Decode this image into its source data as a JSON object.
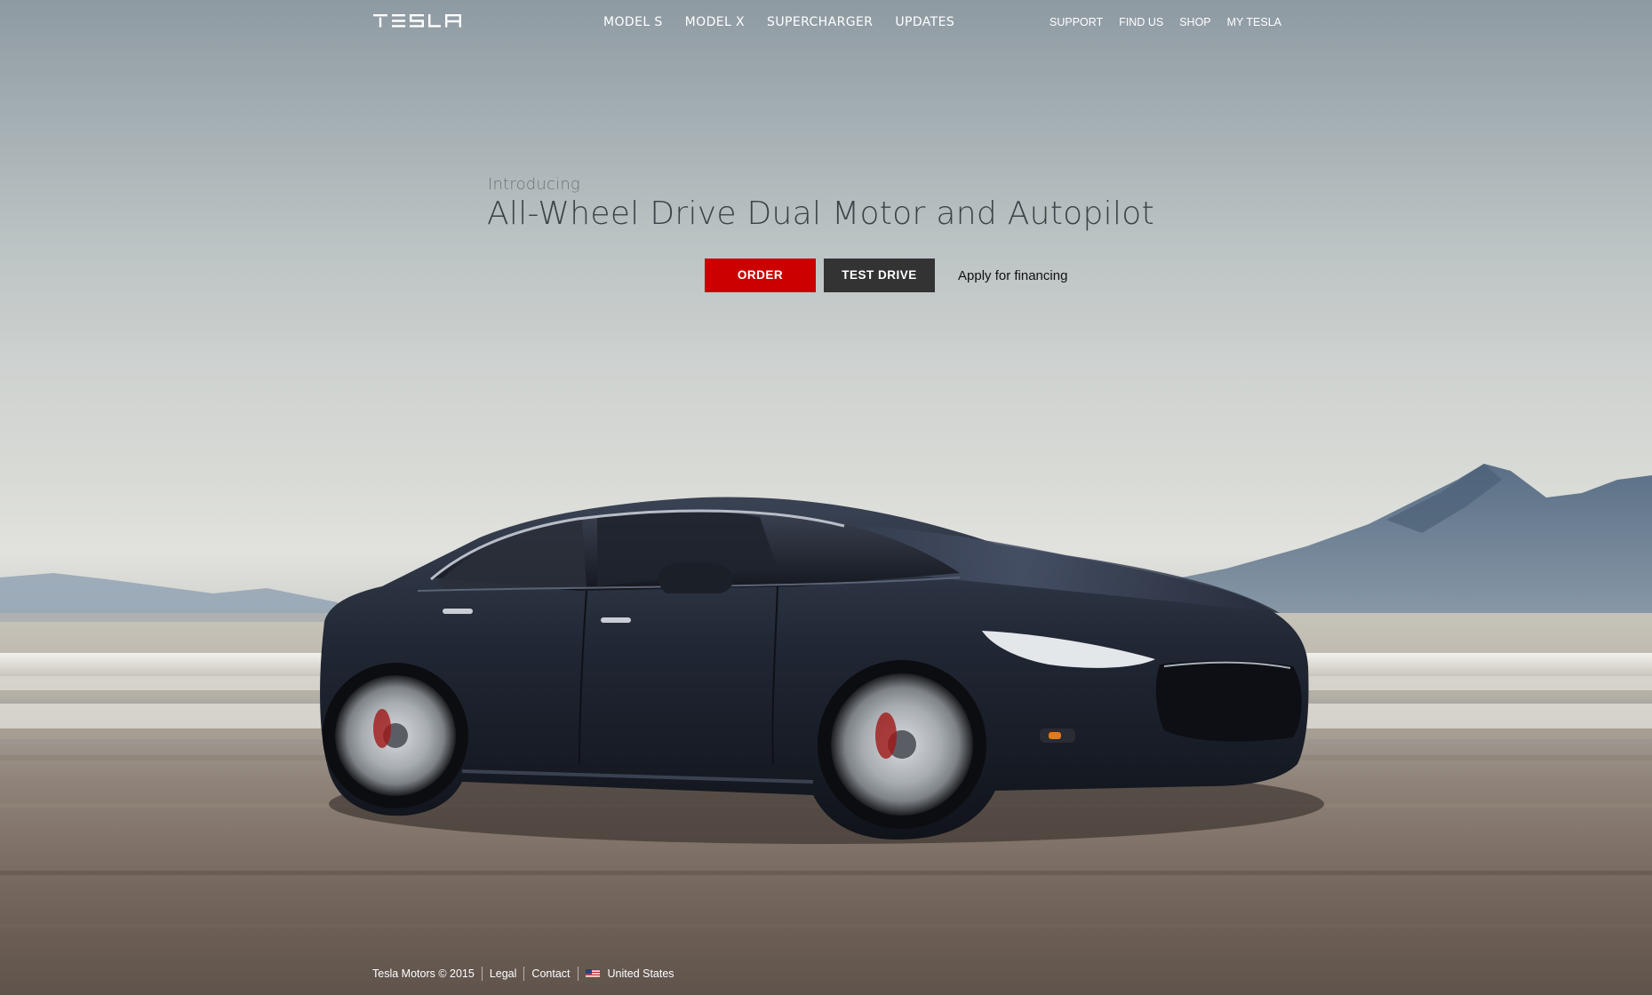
{
  "brand": {
    "logo_text": "TESLA",
    "accent_color": "#cc0000"
  },
  "main_nav": {
    "items": [
      {
        "label": "MODEL S"
      },
      {
        "label": "MODEL X"
      },
      {
        "label": "SUPERCHARGER"
      },
      {
        "label": "UPDATES"
      }
    ]
  },
  "utility_nav": {
    "items": [
      {
        "label": "SUPPORT"
      },
      {
        "label": "FIND US"
      },
      {
        "label": "SHOP"
      },
      {
        "label": "MY TESLA"
      }
    ]
  },
  "hero": {
    "eyebrow": "Introducing",
    "headline": "All-Wheel Drive Dual Motor and Autopilot",
    "order_label": "ORDER",
    "test_drive_label": "TEST DRIVE",
    "financing_label": "Apply for financing",
    "image_subject": "dark-blue-model-s-on-desert-highway"
  },
  "footer": {
    "copyright": "Tesla Motors © 2015",
    "legal_label": "Legal",
    "contact_label": "Contact",
    "region_label": "United States",
    "region_icon": "us-flag-icon"
  }
}
